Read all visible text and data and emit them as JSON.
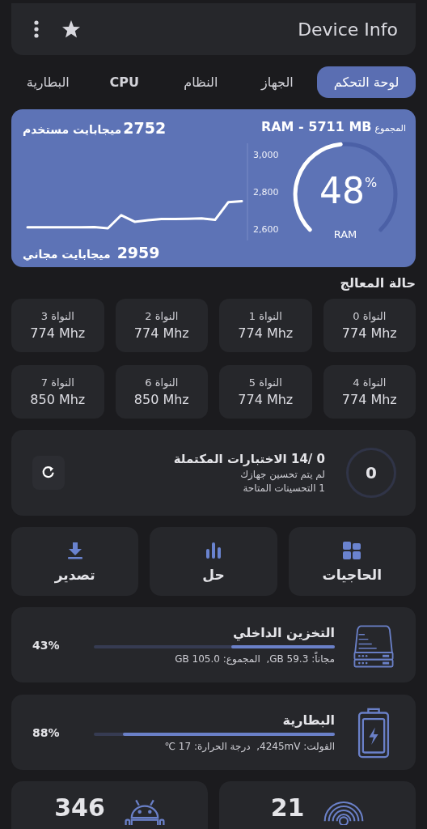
{
  "header": {
    "title": "Device Info"
  },
  "tabs": [
    {
      "label": "لوحة التحكم",
      "selected": true
    },
    {
      "label": "الجهاز",
      "selected": false
    },
    {
      "label": "النظام",
      "selected": false
    },
    {
      "label": "CPU",
      "selected": false
    },
    {
      "label": "البطارية",
      "selected": false
    }
  ],
  "ram": {
    "total_label": "المجموع",
    "total": "RAM - 5711 MB",
    "used_value": "2752",
    "used_label": "ميجابايت مستخدم",
    "free_value": "2959",
    "free_label": "ميجابايت مجاني",
    "percent": "48",
    "percent_sign": "%",
    "gauge_label": "RAM",
    "chart_data": {
      "type": "line",
      "ylim": [
        2540,
        3060
      ],
      "yticks": [
        {
          "value": 2600,
          "label": "2,600"
        },
        {
          "value": 2800,
          "label": "2,800"
        },
        {
          "value": 3000,
          "label": "3,000"
        }
      ],
      "series": [
        {
          "color": "#ffffff",
          "values": [
            2610,
            2610,
            2610,
            2610,
            2610,
            2612,
            2605,
            2675,
            2640,
            2648,
            2655,
            2655,
            2656,
            2658,
            2650,
            2745,
            2750
          ]
        }
      ]
    }
  },
  "cpu": {
    "title": "حالة المعالج",
    "cores": [
      {
        "name": "النواة 0",
        "freq": "774 Mhz"
      },
      {
        "name": "النواة 1",
        "freq": "774 Mhz"
      },
      {
        "name": "النواة 2",
        "freq": "774 Mhz"
      },
      {
        "name": "النواة 3",
        "freq": "774 Mhz"
      },
      {
        "name": "النواة 4",
        "freq": "774 Mhz"
      },
      {
        "name": "النواة 5",
        "freq": "774 Mhz"
      },
      {
        "name": "النواة 6",
        "freq": "850 Mhz"
      },
      {
        "name": "النواة 7",
        "freq": "850 Mhz"
      }
    ]
  },
  "tests": {
    "title": "0 /14 الاختبارات المكتملة",
    "lines": [
      "لم يتم تحسين جهازك",
      "1 التحسينات المتاحة"
    ],
    "score": "0"
  },
  "actions": [
    {
      "label": "الحاجيات",
      "kind": "widgets"
    },
    {
      "label": "حل",
      "kind": "chart"
    },
    {
      "label": "تصدير",
      "kind": "download"
    }
  ],
  "meters": [
    {
      "kind": "storage",
      "title": "التخزين الداخلي",
      "detail": "مجاناً: 59.3 GB,  المجموع: 105.0 GB",
      "percent": "43%",
      "level": 0.43
    },
    {
      "kind": "battery",
      "title": "البطارية",
      "detail": "الفولت: 4245mV,  درجة الحرارة: 17 ℃",
      "percent": "88%",
      "level": 0.88
    }
  ],
  "stats": [
    {
      "kind": "signal",
      "value": "21"
    },
    {
      "kind": "android",
      "value": "346"
    }
  ]
}
